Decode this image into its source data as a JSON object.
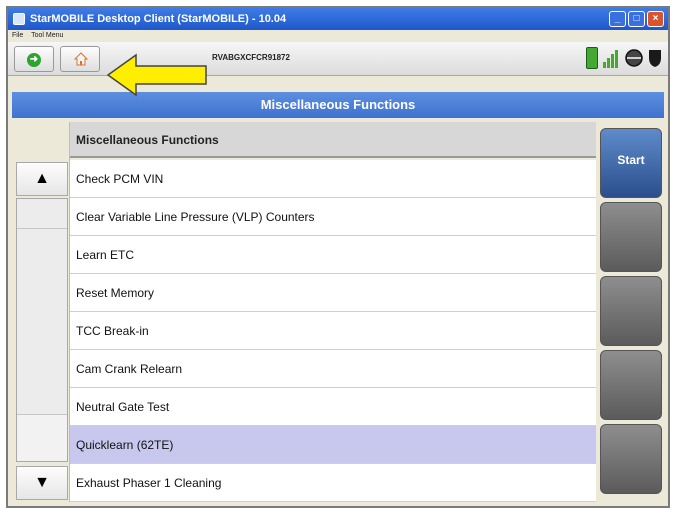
{
  "window": {
    "title": "StarMOBILE Desktop Client (StarMOBILE) - 10.04",
    "controls": [
      "minimize",
      "maximize",
      "close"
    ]
  },
  "menubar": {
    "items": [
      "File",
      "Tool Menu"
    ]
  },
  "toolbar": {
    "vin": "RVABGXCFCR91872",
    "back_icon": "back-arrow-icon",
    "home_icon": "home-icon"
  },
  "header": {
    "title": "Miscellaneous Functions"
  },
  "list": {
    "header": "Miscellaneous Functions",
    "items": [
      {
        "label": "Check PCM VIN",
        "selected": false
      },
      {
        "label": "Clear Variable Line Pressure (VLP) Counters",
        "selected": false
      },
      {
        "label": "Learn ETC",
        "selected": false
      },
      {
        "label": "Reset Memory",
        "selected": false
      },
      {
        "label": "TCC Break-in",
        "selected": false
      },
      {
        "label": "Cam Crank Relearn",
        "selected": false
      },
      {
        "label": "Neutral Gate Test",
        "selected": false
      },
      {
        "label": "Quicklearn (62TE)",
        "selected": true
      },
      {
        "label": "Exhaust Phaser 1 Cleaning",
        "selected": false
      }
    ]
  },
  "scroll": {
    "up_label": "▲",
    "down_label": "▼"
  },
  "right_buttons": {
    "start_label": "Start"
  },
  "colors": {
    "header_blue": "#4a7fd6",
    "selected_row": "#c8c8ee",
    "start_blue": "#3b64a8",
    "callout_arrow": "#ffee00"
  }
}
